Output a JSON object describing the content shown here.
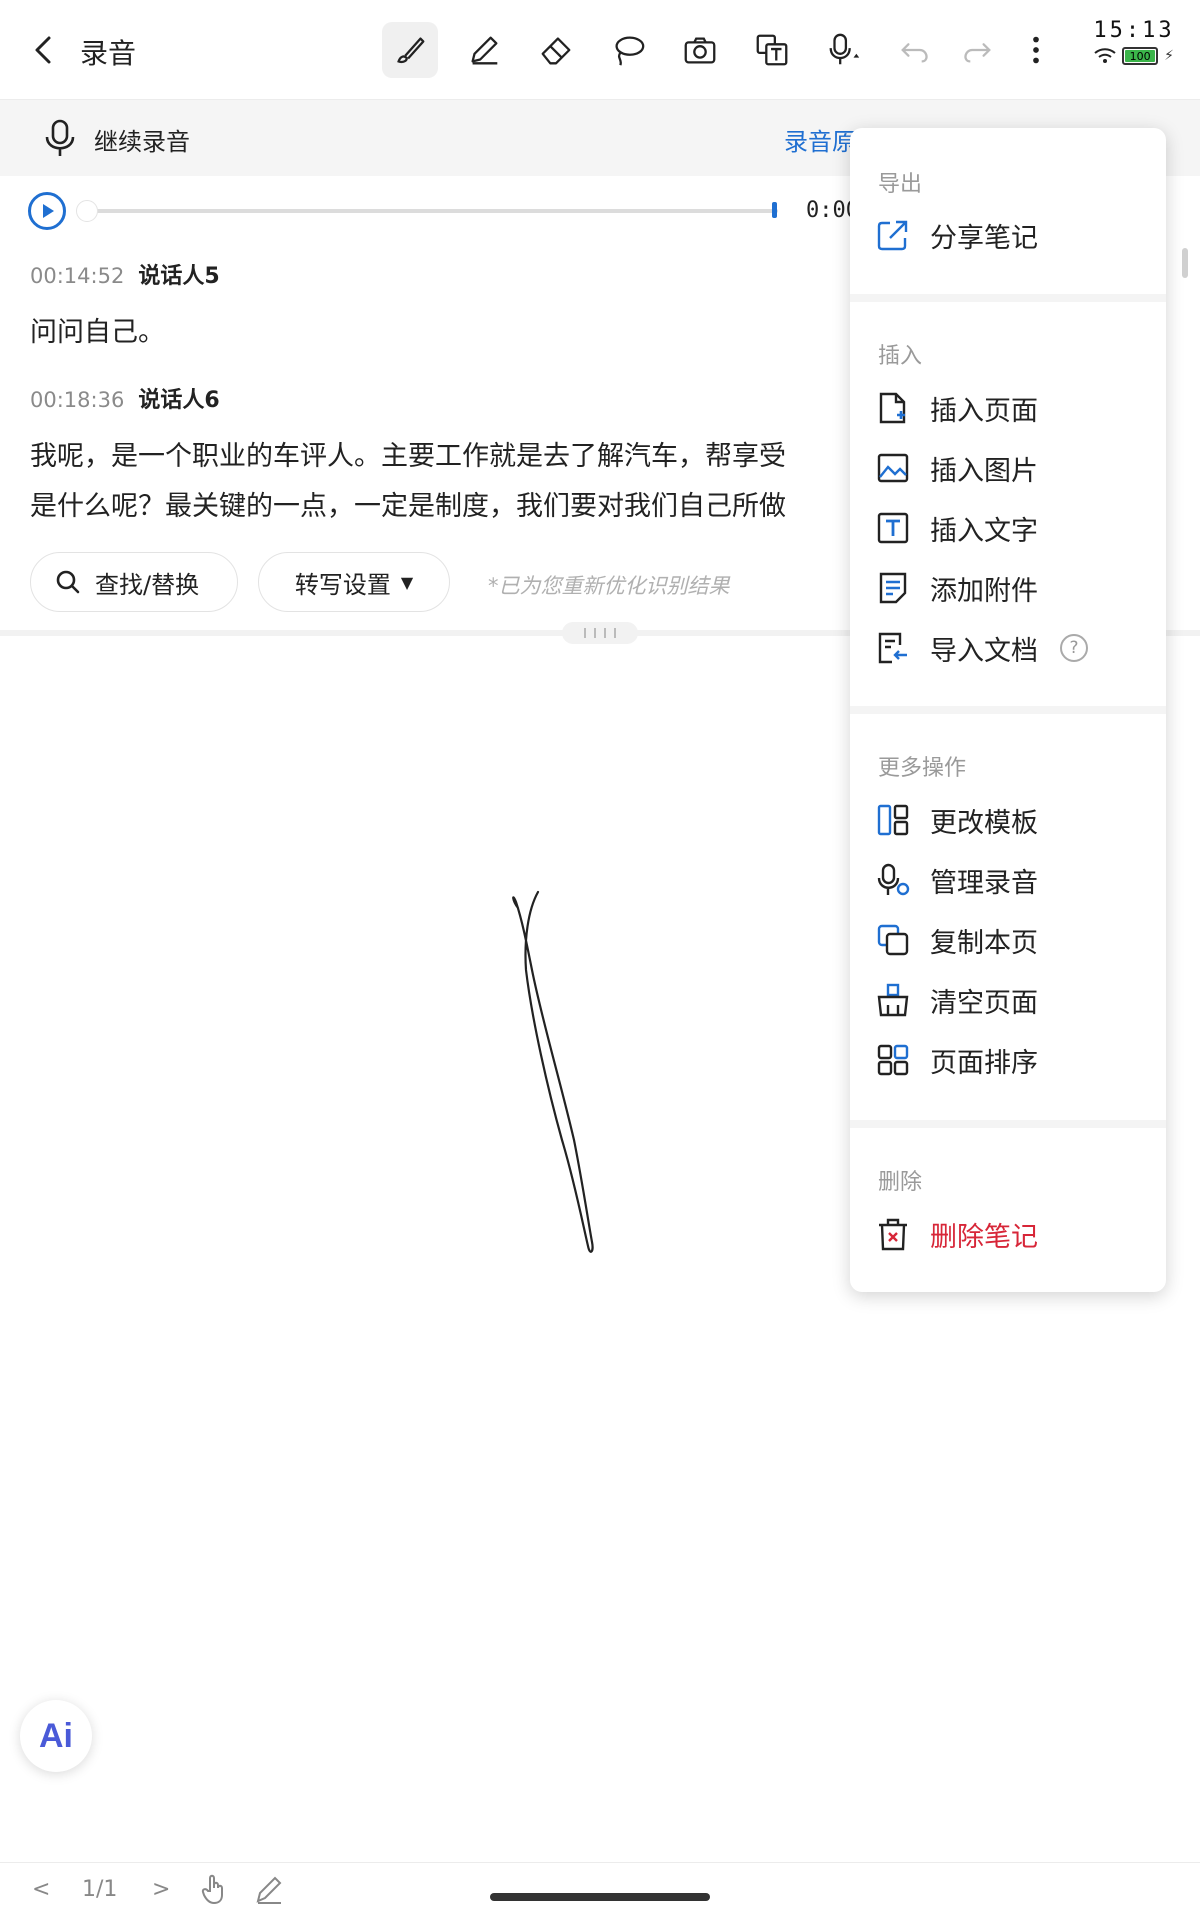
{
  "header": {
    "title": "录音",
    "clock": "15:13",
    "battery": "100"
  },
  "toolbar": {
    "tools": [
      "brush-icon",
      "pen-icon",
      "eraser-icon",
      "lasso-icon",
      "camera-icon",
      "text-recognize-icon",
      "voice-input-icon",
      "undo-icon",
      "redo-icon",
      "more-icon"
    ],
    "active_tool": "brush-icon"
  },
  "recording": {
    "continue_label": "继续录音",
    "link_label": "录音原"
  },
  "player": {
    "time": "0:00",
    "progress": 0
  },
  "transcript": [
    {
      "time": "00:14:52",
      "speaker": "说话人5",
      "lines": [
        "问问自己。"
      ]
    },
    {
      "time": "00:18:36",
      "speaker": "说话人6",
      "lines": [
        "我呢，是一个职业的车评人。主要工作就是去了解汽车，帮享受",
        "是什么呢？最关键的一点，一定是制度，我们要对我们自己所做"
      ]
    }
  ],
  "actions": {
    "search_label": "查找/替换",
    "settings_label": "转写设置",
    "hint": "*已为您重新优化识别结果"
  },
  "menu": {
    "export_title": "导出",
    "share": "分享笔记",
    "insert_title": "插入",
    "insert_page": "插入页面",
    "insert_image": "插入图片",
    "insert_text": "插入文字",
    "add_attachment": "添加附件",
    "import_doc": "导入文档",
    "help_glyph": "?",
    "more_title": "更多操作",
    "change_template": "更改模板",
    "manage_recording": "管理录音",
    "copy_page": "复制本页",
    "clear_page": "清空页面",
    "sort_pages": "页面排序",
    "delete_title": "删除",
    "delete_note": "删除笔记"
  },
  "ai": {
    "label": "Ai"
  },
  "footer": {
    "prev": "<",
    "page": "1/1",
    "next": ">"
  },
  "colors": {
    "accent": "#1f6fd1",
    "danger": "#d72638",
    "muted": "#9a9a9a"
  }
}
